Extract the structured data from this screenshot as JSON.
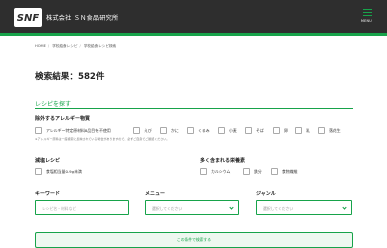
{
  "header": {
    "logo_text": "SNF",
    "company": "株式会社 ＳＮ食品研究所",
    "menu_label": "MENU"
  },
  "breadcrumb": [
    "HOME",
    "学校給食レシピ",
    "学校給食レシピ検索"
  ],
  "result": {
    "label": "検索結果：582件"
  },
  "panel": {
    "title": "レシピを探す"
  },
  "allergy": {
    "title": "除外するアレルギー物質",
    "items": [
      "アレルギー特定原材料8品目を不使用",
      "えび",
      "かに",
      "くるみ",
      "小麦",
      "そば",
      "卵",
      "乳",
      "落花生"
    ],
    "note": "※アレルギー原料は一度検索に反映されている場合がありますので、必ずご自身でご確認ください。"
  },
  "reduced": {
    "title": "減塩レシピ",
    "items": [
      "食塩相当量0.9g未満"
    ]
  },
  "nutrients": {
    "title": "多く含まれる栄養素",
    "items": [
      "カルシウム",
      "鉄分",
      "食物繊維"
    ]
  },
  "keyword": {
    "title": "キーワード",
    "placeholder": "レシピ名・材料など"
  },
  "menu": {
    "title": "メニュー",
    "placeholder": "選択してください"
  },
  "genre": {
    "title": "ジャンル",
    "placeholder": "選択してください"
  },
  "submit": {
    "label": "この条件で検索する"
  },
  "colors": {
    "accent": "#17a34a",
    "header_bg": "#2e2e2e"
  }
}
